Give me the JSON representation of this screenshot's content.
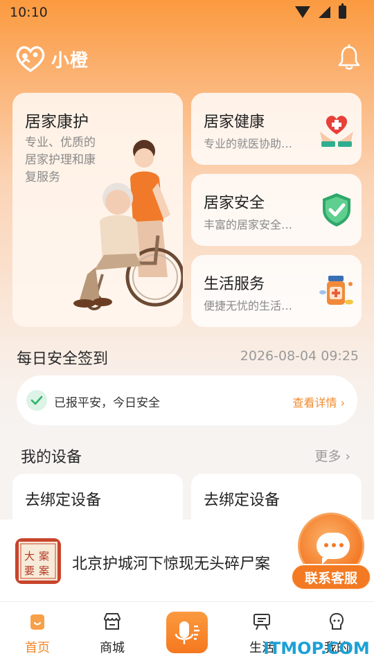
{
  "status_bar": {
    "time": "10:10"
  },
  "header": {
    "brand": "小橙"
  },
  "services": {
    "home_care": {
      "title": "居家康护",
      "desc": "专业、优质的居家护理和康复服务"
    },
    "home_health": {
      "title": "居家健康",
      "desc": "专业的就医协助…"
    },
    "home_safety": {
      "title": "居家安全",
      "desc": "丰富的居家安全…"
    },
    "life_service": {
      "title": "生活服务",
      "desc": "便捷无忧的生活…"
    }
  },
  "checkin": {
    "title": "每日安全签到",
    "datetime": "2026-08-04 09:25",
    "status": "已报平安，今日安全",
    "link": "查看详情 ›"
  },
  "devices": {
    "title": "我的设备",
    "more": "更多 ›",
    "items": [
      {
        "label": "去绑定设备"
      },
      {
        "label": "去绑定设备"
      }
    ]
  },
  "news": {
    "headline": "北京护城河下惊现无头碎尸案",
    "thumb_text": "大案要案"
  },
  "customer_service": {
    "label": "联系客服"
  },
  "bottom_nav": {
    "items": [
      {
        "label": "首页",
        "active": true
      },
      {
        "label": "商城"
      },
      {
        "label": "生活"
      },
      {
        "label": "我的"
      }
    ]
  },
  "watermark": "ITMOP.COM",
  "colors": {
    "accent": "#f38626",
    "brand_gradient_top": "#fb9a3f",
    "check_green": "#2fb36b"
  }
}
